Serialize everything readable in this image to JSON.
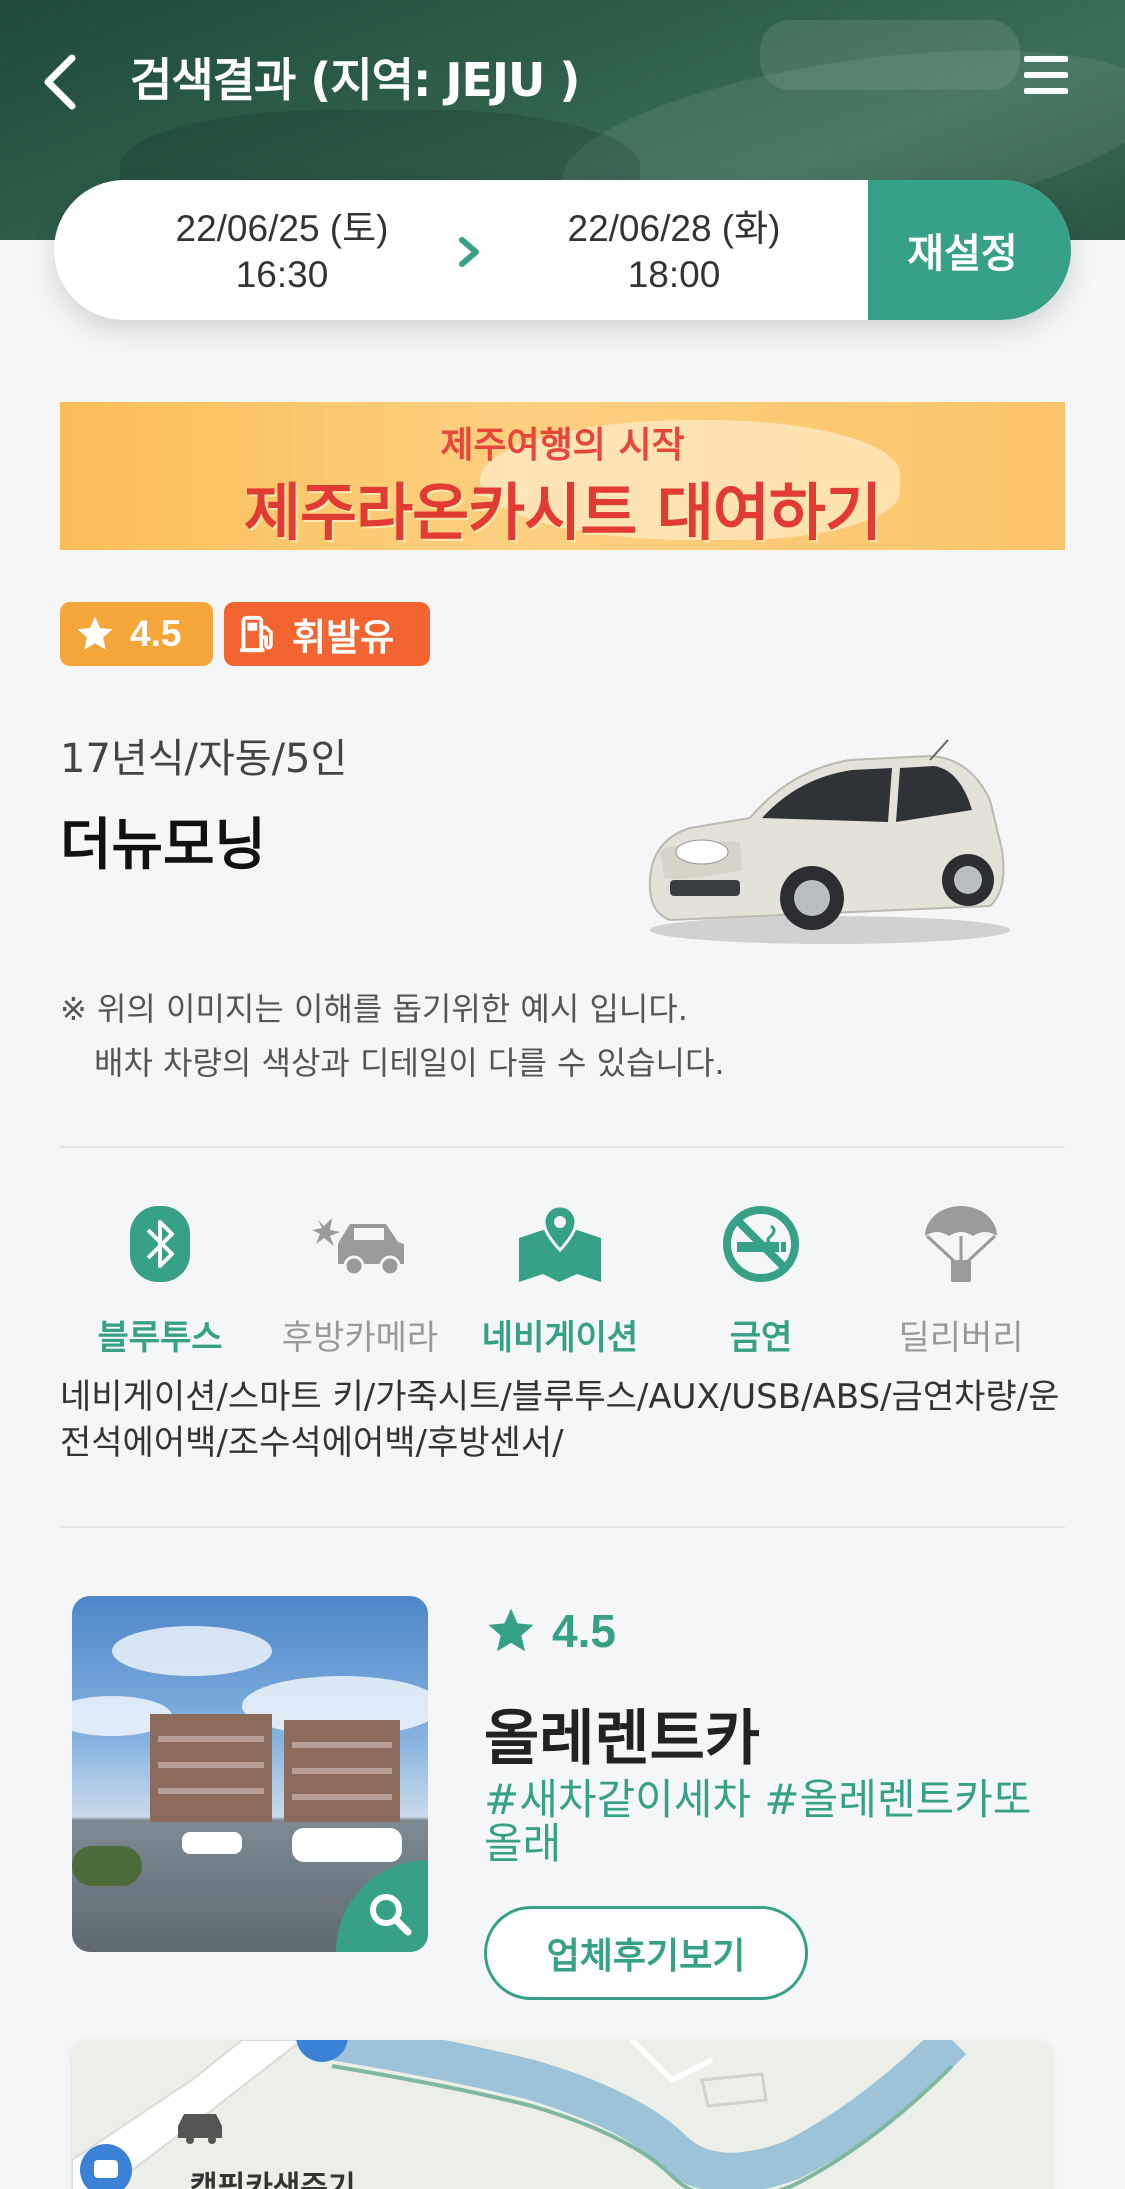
{
  "header": {
    "title": "검색결과 (지역: JEJU )",
    "back_icon": "chevron-left-icon",
    "menu_icon": "hamburger-menu-icon"
  },
  "date_bar": {
    "from_date": "22/06/25 (토)",
    "from_time": "16:30",
    "to_date": "22/06/28 (화)",
    "to_time": "18:00",
    "reset_label": "재설정",
    "accent": "#36a186"
  },
  "banner": {
    "subtitle": "제주여행의 시작",
    "title": "제주라온카시트 대여하기"
  },
  "car": {
    "rating": "4.5",
    "fuel": "휘발유",
    "spec": "17년식/자동/5인",
    "name": "더뉴모닝",
    "disclaimer_line1": "※ 위의 이미지는 이해를 돕기위한 예시 입니다.",
    "disclaimer_line2": "배차 차량의 색상과 디테일이 다를 수 있습니다.",
    "features": [
      {
        "label": "블루투스",
        "icon": "bluetooth-icon",
        "active": true
      },
      {
        "label": "후방카메라",
        "icon": "rear-camera-icon",
        "active": false
      },
      {
        "label": "네비게이션",
        "icon": "navigation-map-icon",
        "active": true
      },
      {
        "label": "금연",
        "icon": "no-smoking-icon",
        "active": true
      },
      {
        "label": "딜리버리",
        "icon": "delivery-parachute-icon",
        "active": false
      }
    ],
    "options": "네비게이션/스마트 키/가죽시트/블루투스/AUX/USB/ABS/금연차량/운전석에어백/조수석에어백/후방센서/"
  },
  "company": {
    "rating": "4.5",
    "name": "올레렌트카",
    "tags": "#새차같이세차 #올레렌트카또올래",
    "review_button": "업체후기보기"
  },
  "map": {
    "label": "캠핑카샌주기"
  }
}
